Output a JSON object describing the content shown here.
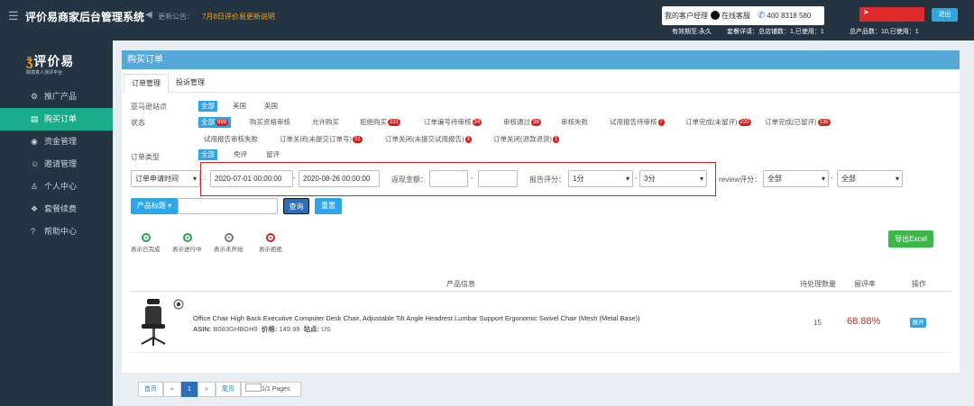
{
  "header": {
    "title": "评价易商家后台管理系统",
    "notice_label": "更新公告：",
    "notice_link": "7月8日评价易更新说明",
    "manager": "我的客户经理",
    "online_service": "在线客服",
    "phone": "400 8318 580",
    "logout": "退出",
    "valid": "有效期至:永久",
    "package": "套餐详请：总店铺数：1,已使用：1",
    "products": "总产品数：10,已使用：1"
  },
  "sidebar": {
    "logo": "评价易",
    "logo_tagline": "跨境真人测评平台",
    "items": [
      {
        "icon": "⚙",
        "label": "推广产品"
      },
      {
        "icon": "▤",
        "label": "购买订单"
      },
      {
        "icon": "◉",
        "label": "资金管理"
      },
      {
        "icon": "☺",
        "label": "邀请管理"
      },
      {
        "icon": "♙",
        "label": "个人中心"
      },
      {
        "icon": "❖",
        "label": "套餐续费"
      },
      {
        "icon": "?",
        "label": "帮助中心"
      }
    ]
  },
  "panel": {
    "title": "购买订单",
    "tabs": [
      "订单管理",
      "投诉管理"
    ],
    "site_label": "亚马逊站点",
    "sites": [
      "全部",
      "美国",
      "英国"
    ],
    "status_label": "状态",
    "statuses_row1": [
      {
        "text": "全部",
        "badge": "699"
      },
      {
        "text": "购买资格审核",
        "badge": ""
      },
      {
        "text": "允许购买",
        "badge": ""
      },
      {
        "text": "拒绝购买",
        "badge": "231"
      },
      {
        "text": "订单编号待审核",
        "badge": "34"
      },
      {
        "text": "审核通过",
        "badge": "36"
      },
      {
        "text": "审核失败",
        "badge": ""
      },
      {
        "text": "试用报告待审核",
        "badge": "7"
      },
      {
        "text": "订单完成(未留评)",
        "badge": "220"
      },
      {
        "text": "订单完成(已留评)",
        "badge": "135"
      }
    ],
    "statuses_row2": [
      {
        "text": "试用报告审核失败",
        "badge": ""
      },
      {
        "text": "订单关闭(未提交订单号)",
        "badge": "31"
      },
      {
        "text": "订单关闭(未提交试用报告)",
        "badge": "3"
      },
      {
        "text": "订单关闭(退款退货)",
        "badge": "1"
      }
    ],
    "type_label": "订单类型",
    "types": [
      "全部",
      "免评",
      "留评"
    ],
    "filter": {
      "time_select": "订单申请时间",
      "date_from": "2020-07-01 00:00:00",
      "date_to": "2020-08-26 00:00:00",
      "refund_label": "返现金额：",
      "score_label": "报告评分：",
      "score_from": "1分",
      "score_to": "3分",
      "review_label": "review评分：",
      "review_from": "全部",
      "review_to": "全部",
      "product_select": "产品标题",
      "search": "查询",
      "reset": "重置"
    },
    "legend": [
      "表示已完成",
      "表示进行中",
      "表示未开始",
      "表示拒绝"
    ],
    "export": "导出Excel",
    "table": {
      "headers": [
        "产品信息",
        "待处理数量",
        "留评率",
        "操作"
      ],
      "row": {
        "title": "Office Chair High Back Executive Computer Desk Chair, Adjustable Tilt Angle Headrest Lumbar Support Ergonomic Swivel Chair (Mesh (Metal Base))",
        "asin_label": "ASIN:",
        "asin": "B083GHBGH9",
        "price_label": "价格:",
        "price": "149.99",
        "site_label": "站点:",
        "site": "US",
        "pending": "15",
        "rate": "68.88%",
        "action": "展开"
      }
    },
    "pager": {
      "first": "首页",
      "prev": "«",
      "current": "1",
      "next": "»",
      "last": "尾页",
      "pages": "1/1 Pages"
    }
  },
  "colors": {
    "topbar": "#253443",
    "active": "#1aab8a",
    "primary": "#2da5e8",
    "badge": "#d9221c",
    "export": "#3cb84a"
  }
}
